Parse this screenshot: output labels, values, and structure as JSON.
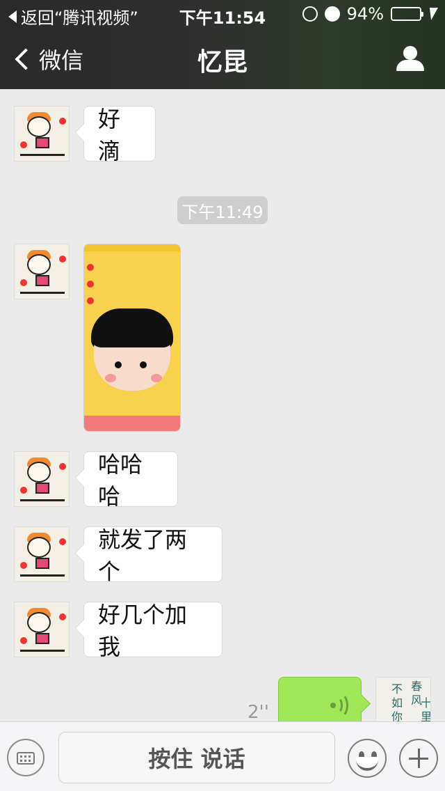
{
  "status_bar": {
    "back_app": "返回“腾讯视频”",
    "time": "下午11:54",
    "battery": "94%",
    "battery_level": 0.94,
    "icons": [
      "orientation-lock-icon",
      "alarm-icon",
      "battery-icon",
      "charging-bolt-icon"
    ]
  },
  "nav": {
    "back_label": "微信",
    "title": "忆昆",
    "profile_icon": "person-icon"
  },
  "messages": [
    {
      "side": "left",
      "type": "text",
      "text": "好滴"
    },
    {
      "type": "timestamp",
      "text": "下午11:49"
    },
    {
      "side": "left",
      "type": "image",
      "image_desc": "screenshot-thumbnail"
    },
    {
      "side": "left",
      "type": "text",
      "text": "哈哈哈"
    },
    {
      "side": "left",
      "type": "text",
      "text": "就发了两个"
    },
    {
      "side": "left",
      "type": "text",
      "text": "好几个加我"
    },
    {
      "side": "right",
      "type": "voice",
      "duration": "2''"
    }
  ],
  "input_bar": {
    "keyboard_icon": "keyboard-icon",
    "press_to_talk": "按住 说话",
    "emoji_icon": "emoji-icon",
    "plus_icon": "plus-icon"
  },
  "self_avatar_text": [
    "春",
    "风",
    "十",
    "里",
    "不",
    "如",
    "你"
  ]
}
